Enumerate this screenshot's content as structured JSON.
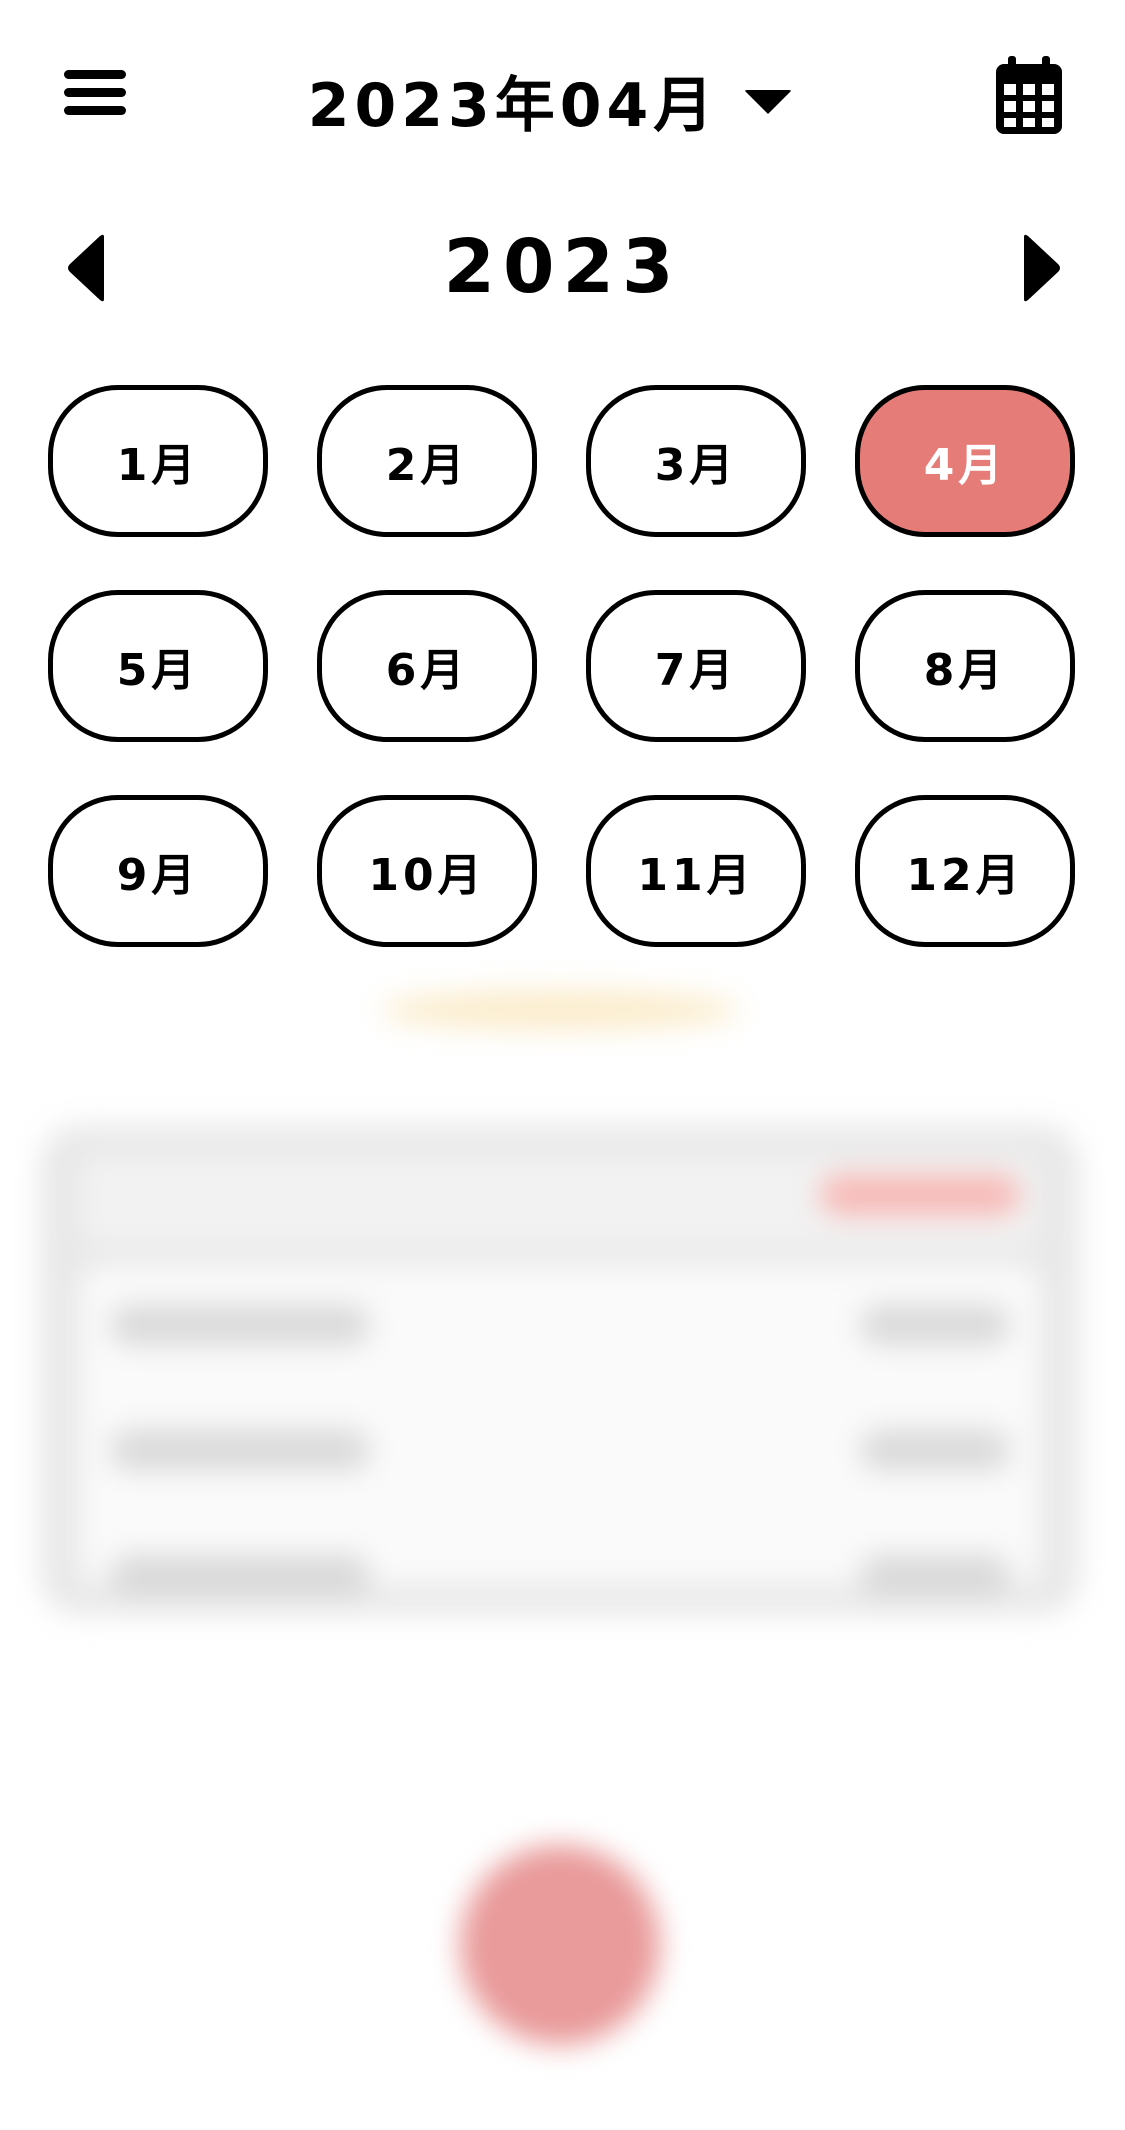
{
  "header": {
    "current_month_label": "2023年04月",
    "menu_icon": "hamburger-menu-icon",
    "dropdown_icon": "caret-down-icon",
    "calendar_icon": "calendar-icon"
  },
  "picker": {
    "year_label": "2023",
    "prev_icon": "caret-left-icon",
    "next_icon": "caret-right-icon",
    "selected_month": "4月",
    "months": [
      "1月",
      "2月",
      "3月",
      "4月",
      "5月",
      "6月",
      "7月",
      "8月",
      "9月",
      "10月",
      "11月",
      "12月"
    ]
  },
  "colors": {
    "accent": "#e67c78",
    "text": "#000000",
    "background": "#ffffff"
  }
}
